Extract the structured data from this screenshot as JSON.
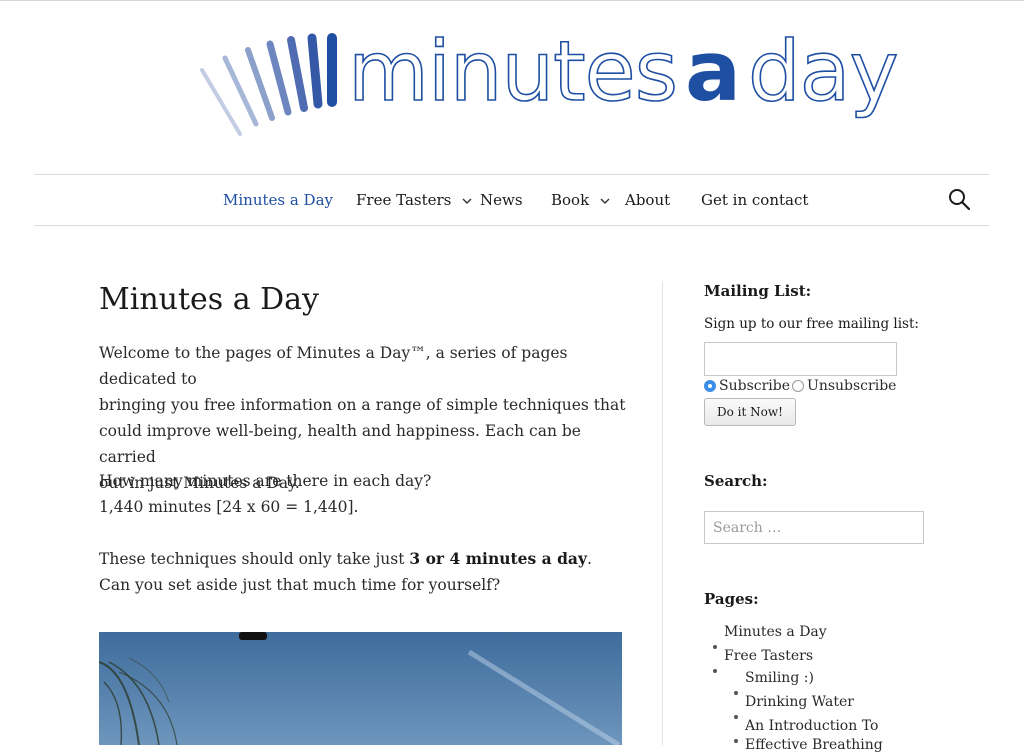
{
  "brand": {
    "wordmark_part1": "minutes",
    "wordmark_part2": "a",
    "wordmark_part3": "day",
    "color": "#1f4fa3"
  },
  "nav": {
    "items": [
      {
        "label": "Minutes a Day",
        "active": true
      },
      {
        "label": "Free Tasters",
        "has_submenu": true
      },
      {
        "label": "News"
      },
      {
        "label": "Book",
        "has_submenu": true
      },
      {
        "label": "About"
      },
      {
        "label": "Get in contact"
      }
    ],
    "chevron": "⌄",
    "search_icon": "search-icon"
  },
  "main": {
    "title": "Minutes a Day",
    "p1_line1": "Welcome to the pages of Minutes a Day™, a series of pages dedicated to",
    "p1_line2": "bringing you free information on a range of simple techniques that",
    "p1_line3": "could improve well-being, health and happiness. Each can be carried",
    "p1_line4": "out in just Minutes a Day.",
    "p2_line1": "How many minutes are there in each day?",
    "p2_line2": "1,440 minutes [24 x 60 = 1,440].",
    "p3_pre": "These techniques should only take just ",
    "p3_bold": "3 or 4 minutes a day",
    "p3_post": ".",
    "p3_line2": "Can you set aside just that much time for yourself?"
  },
  "sidebar": {
    "mailing": {
      "title": "Mailing List:",
      "signup_label": "Sign up to our free mailing list:",
      "email_value": "",
      "subscribe_label": "Subscribe",
      "unsubscribe_label": "Unsubscribe",
      "selected": "subscribe",
      "button_label": "Do it Now!"
    },
    "search": {
      "title": "Search:",
      "placeholder": "Search …"
    },
    "pages": {
      "title": "Pages:",
      "items": [
        "Minutes a Day",
        "Free Tasters",
        "Smiling :)",
        "Drinking Water",
        "An Introduction To",
        "Effective Breathing"
      ]
    }
  }
}
